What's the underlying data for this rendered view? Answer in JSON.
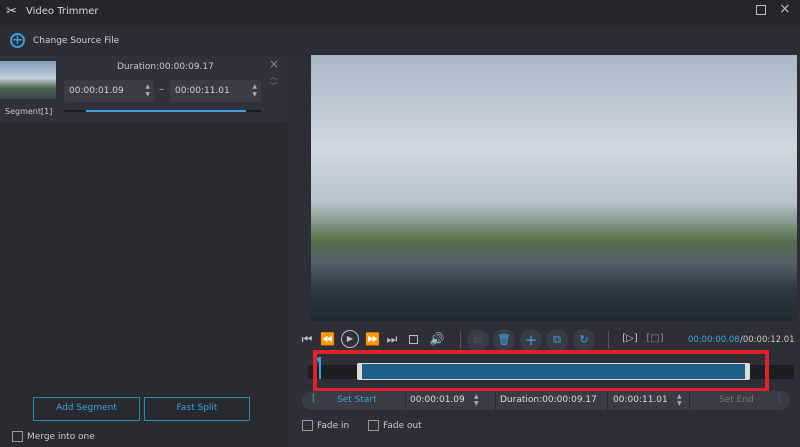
{
  "app": {
    "title": "Video Trimmer",
    "icon": "scissors-icon"
  },
  "toolbar": {
    "change_source": "Change Source File"
  },
  "segment": {
    "label": "Segment[1]",
    "duration": "Duration:00:00:09.17",
    "start": "00:00:01.09",
    "end": "00:00:11.01",
    "separator": "–"
  },
  "left_buttons": {
    "add_segment": "Add Segment",
    "fast_split": "Fast Split",
    "merge": "Merge into one"
  },
  "player": {
    "current_time": "00:00:00.08",
    "total_time": "/00:00:12.01"
  },
  "trim": {
    "set_start": "Set Start",
    "start": "00:00:01.09",
    "duration": "Duration:00:00:09.17",
    "end": "00:00:11.01",
    "set_end": "Set End",
    "bracket_open": "[",
    "bracket_close": "]"
  },
  "fades": {
    "fade_in": "Fade in",
    "fade_out": "Fade out"
  },
  "colors": {
    "accent": "#3aa3df",
    "highlight": "#e0202a",
    "timeline_fill": "#1e6088"
  }
}
